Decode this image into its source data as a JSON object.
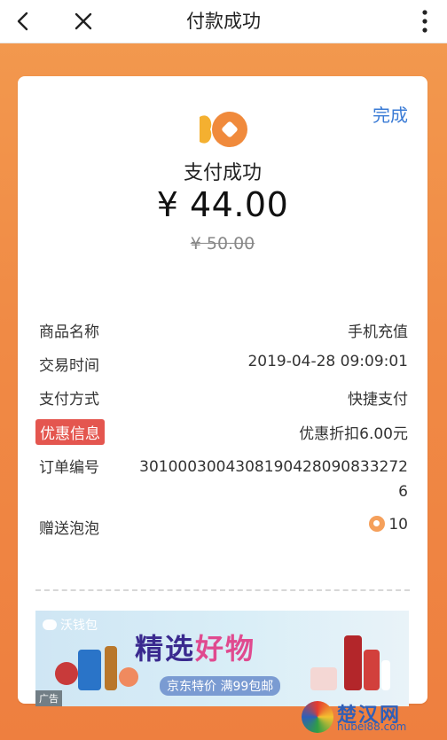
{
  "header": {
    "title": "付款成功"
  },
  "card": {
    "done_label": "完成",
    "status_text": "支付成功",
    "amount": "¥ 44.00",
    "original_amount": "¥ 50.00"
  },
  "details": [
    {
      "label": "商品名称",
      "value": "手机充值"
    },
    {
      "label": "交易时间",
      "value": "2019-04-28 09:09:01"
    },
    {
      "label": "支付方式",
      "value": "快捷支付"
    },
    {
      "label": "优惠信息",
      "value": "优惠折扣6.00元"
    },
    {
      "label": "订单编号",
      "value": "3010003004308190428090833272\n6"
    },
    {
      "label": "赠送泡泡",
      "value": "10"
    }
  ],
  "ad": {
    "brand": "沃钱包",
    "headline_part1": "精选",
    "headline_part2": "好物",
    "subline": "京东特价 满99包邮",
    "tag": "广告"
  },
  "watermark": {
    "name": "楚汉网",
    "url": "hubei88.com"
  },
  "colors": {
    "accent_blue": "#3a7bd5",
    "highlight_red": "#e4564f",
    "brand_orange": "#f39a4f"
  },
  "icons": [
    "back-icon",
    "close-icon",
    "more-icon",
    "brand-logo-icon",
    "bubble-icon"
  ]
}
